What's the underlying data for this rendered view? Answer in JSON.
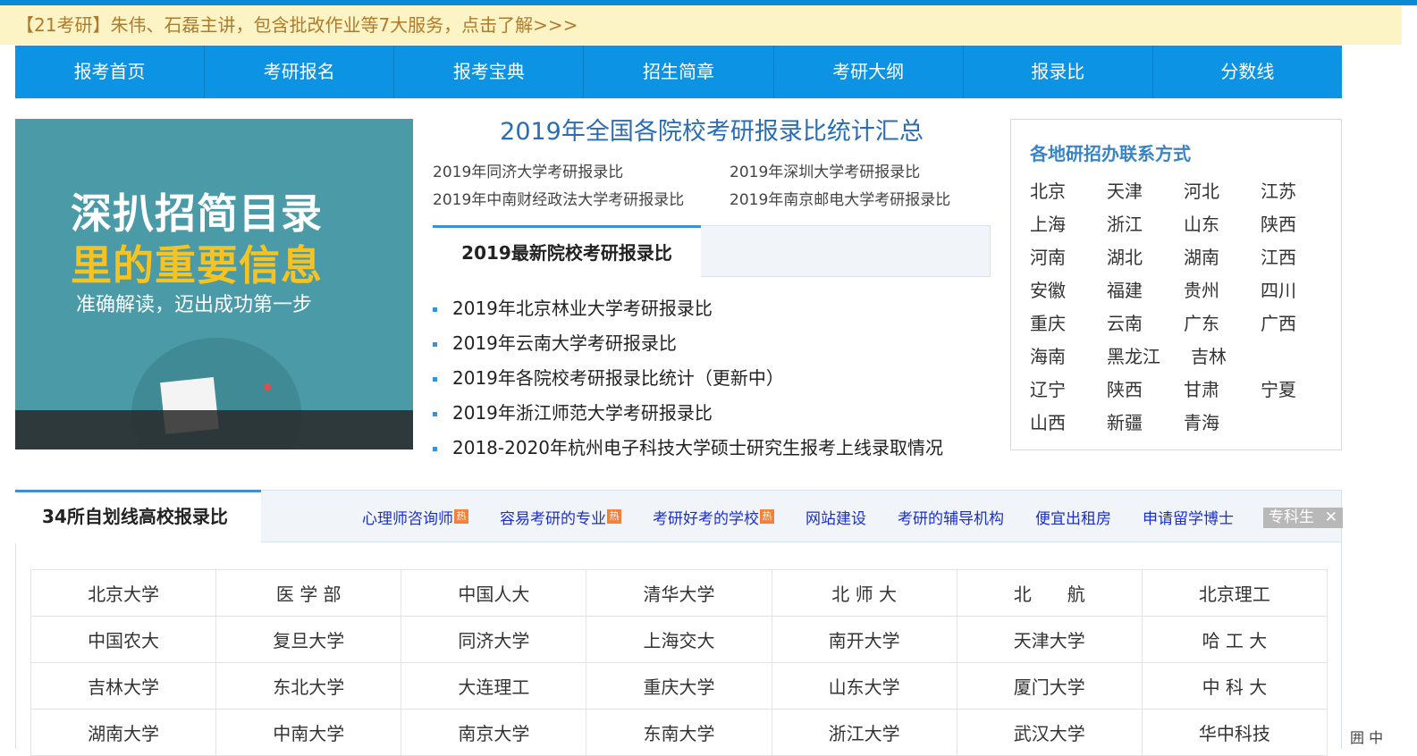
{
  "promo": {
    "text": "【21考研】朱伟、石磊主讲，包含批改作业等7大服务，点击了解>>>"
  },
  "nav": {
    "items": [
      "报考首页",
      "考研报名",
      "报考宝典",
      "招生简章",
      "考研大纲",
      "报录比",
      "分数线"
    ]
  },
  "banner": {
    "line1": "深扒招简目录",
    "line2": "里的重要信息",
    "line3": "准确解读，迈出成功第一步"
  },
  "main": {
    "headline": "2019年全国各院校考研报录比统计汇总",
    "links": [
      "2019年同济大学考研报录比",
      "2019年深圳大学考研报录比",
      "2019年中南财经政法大学考研报录比",
      "2019年南京邮电大学考研报录比"
    ],
    "tab_label": "2019最新院校考研报录比",
    "list": [
      "2019年北京林业大学考研报录比",
      "2019年云南大学考研报录比",
      "2019年各院校考研报录比统计（更新中）",
      "2019年浙江师范大学考研报录比",
      "2018-2020年杭州电子科技大学硕士研究生报考上线录取情况"
    ]
  },
  "contact": {
    "title": "各地研招办联系方式",
    "regions": [
      "北京",
      "天津",
      "河北",
      "江苏",
      "上海",
      "浙江",
      "山东",
      "陕西",
      "河南",
      "湖北",
      "湖南",
      "江西",
      "安徽",
      "福建",
      "贵州",
      "四川",
      "重庆",
      "云南",
      "广东",
      "广西",
      "海南",
      "黑龙江",
      "吉林",
      "",
      "辽宁",
      "陕西",
      "甘肃",
      "宁夏",
      "山西",
      "新疆",
      "青海",
      ""
    ]
  },
  "lower": {
    "tab_label": "34所自划线高校报录比",
    "ads": [
      {
        "label": "心理师咨询师",
        "hot": true
      },
      {
        "label": "容易考研的专业",
        "hot": true
      },
      {
        "label": "考研好考的学校",
        "hot": true
      },
      {
        "label": "网站建设",
        "hot": false
      },
      {
        "label": "考研的辅导机构",
        "hot": false
      },
      {
        "label": "便宜出租房",
        "hot": false
      },
      {
        "label": "申请留学博士",
        "hot": false
      }
    ],
    "hot_badge": "热",
    "ad_box": {
      "label": "专科生",
      "close": "✕"
    },
    "schools": [
      [
        "北京大学",
        "医 学 部",
        "中国人大",
        "清华大学",
        "北 师 大",
        "北　　航",
        "北京理工"
      ],
      [
        "中国农大",
        "复旦大学",
        "同济大学",
        "上海交大",
        "南开大学",
        "天津大学",
        "哈 工 大"
      ],
      [
        "吉林大学",
        "东北大学",
        "大连理工",
        "重庆大学",
        "山东大学",
        "厦门大学",
        "中 科 大"
      ],
      [
        "湖南大学",
        "中南大学",
        "南京大学",
        "东南大学",
        "浙江大学",
        "武汉大学",
        "华中科技"
      ]
    ]
  },
  "corner": {
    "text": "囲 中"
  }
}
